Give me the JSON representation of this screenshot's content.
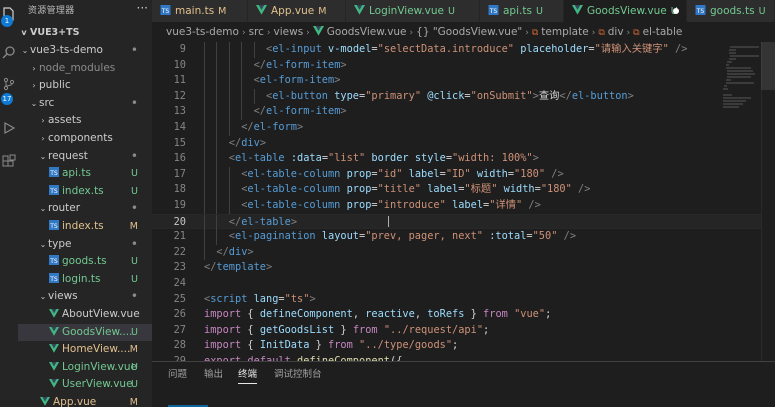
{
  "sidebar": {
    "title": "资源管理器",
    "section": "VUE3+TS",
    "items": [
      {
        "label": "vue3-ts-demo",
        "chev": "v",
        "depth": 1,
        "kind": "folder",
        "status": "•",
        "st": "dot"
      },
      {
        "label": "node_modules",
        "chev": ">",
        "depth": 2,
        "kind": "dim",
        "status": "",
        "st": ""
      },
      {
        "label": "public",
        "chev": ">",
        "depth": 2,
        "kind": "folder",
        "status": "",
        "st": ""
      },
      {
        "label": "src",
        "chev": "v",
        "depth": 2,
        "kind": "folder",
        "status": "•",
        "st": "dot"
      },
      {
        "label": "assets",
        "chev": ">",
        "depth": 3,
        "kind": "folder",
        "status": "",
        "st": ""
      },
      {
        "label": "components",
        "chev": ">",
        "depth": 3,
        "kind": "folder",
        "status": "",
        "st": ""
      },
      {
        "label": "request",
        "chev": "v",
        "depth": 3,
        "kind": "ts",
        "status": "•",
        "st": "dot"
      },
      {
        "label": "api.ts",
        "chev": "",
        "depth": 4,
        "kind": "tsfile",
        "status": "U",
        "st": "u"
      },
      {
        "label": "index.ts",
        "chev": "",
        "depth": 4,
        "kind": "tsfile",
        "status": "U",
        "st": "u"
      },
      {
        "label": "router",
        "chev": "v",
        "depth": 3,
        "kind": "folder",
        "status": "•",
        "st": "dot"
      },
      {
        "label": "index.ts",
        "chev": "",
        "depth": 4,
        "kind": "tsfilem",
        "status": "M",
        "st": "m"
      },
      {
        "label": "type",
        "chev": "v",
        "depth": 3,
        "kind": "ts",
        "status": "•",
        "st": "dot"
      },
      {
        "label": "goods.ts",
        "chev": "",
        "depth": 4,
        "kind": "tsfile",
        "status": "U",
        "st": "u"
      },
      {
        "label": "login.ts",
        "chev": "",
        "depth": 4,
        "kind": "tsfile",
        "status": "U",
        "st": "u"
      },
      {
        "label": "views",
        "chev": "v",
        "depth": 3,
        "kind": "folder",
        "status": "•",
        "st": "dot"
      },
      {
        "label": "AboutView.vue",
        "chev": "",
        "depth": 4,
        "kind": "vue",
        "status": "",
        "st": ""
      },
      {
        "label": "GoodsView....",
        "chev": "",
        "depth": 4,
        "kind": "vueu",
        "status": "U",
        "st": "u",
        "selected": true
      },
      {
        "label": "HomeView....",
        "chev": "",
        "depth": 4,
        "kind": "vuem",
        "status": "M",
        "st": "m"
      },
      {
        "label": "LoginView.vue",
        "chev": "",
        "depth": 4,
        "kind": "vueu",
        "status": "U",
        "st": "u"
      },
      {
        "label": "UserView.vue",
        "chev": "",
        "depth": 4,
        "kind": "vueu",
        "status": "U",
        "st": "u"
      },
      {
        "label": "App.vue",
        "chev": "",
        "depth": 3,
        "kind": "vuem",
        "status": "M",
        "st": "m"
      }
    ]
  },
  "activity_badges": [
    "1",
    "17"
  ],
  "tabs": [
    {
      "label": "main.ts",
      "badge": "M",
      "icon": "ts",
      "kind": "m"
    },
    {
      "label": "App.vue",
      "badge": "M",
      "icon": "vue",
      "kind": "m"
    },
    {
      "label": "LoginView.vue",
      "badge": "U",
      "icon": "vue",
      "kind": "u"
    },
    {
      "label": "api.ts",
      "badge": "U",
      "icon": "ts",
      "kind": "u"
    },
    {
      "label": "GoodsView.vue",
      "badge": "U",
      "icon": "vue",
      "kind": "u",
      "active": true
    },
    {
      "label": "goods.ts",
      "badge": "U",
      "icon": "ts",
      "kind": "u"
    }
  ],
  "breadcrumb": [
    "vue3-ts-demo",
    "src",
    "views",
    "GoodsView.vue",
    "{} \"GoodsView.vue\"",
    "template",
    "div",
    "el-table"
  ],
  "editor": {
    "current_line": 20,
    "lines": [
      {
        "n": 9,
        "indent": 6,
        "tokens": [
          [
            "t-pun",
            "<"
          ],
          [
            "t-tag",
            "el-input"
          ],
          [
            "t-txt",
            " "
          ],
          [
            "t-attr",
            "v-model"
          ],
          [
            "t-txt",
            "="
          ],
          [
            "t-str",
            "\"selectData.introduce\""
          ],
          [
            "t-txt",
            " "
          ],
          [
            "t-attr",
            "placeholder"
          ],
          [
            "t-txt",
            "="
          ],
          [
            "t-str",
            "\"请输入关键字\""
          ],
          [
            "t-txt",
            " "
          ],
          [
            "t-pun",
            "/>"
          ]
        ]
      },
      {
        "n": 10,
        "indent": 5,
        "tokens": [
          [
            "t-pun",
            "</"
          ],
          [
            "t-tag",
            "el-form-item"
          ],
          [
            "t-pun",
            ">"
          ]
        ]
      },
      {
        "n": 11,
        "indent": 5,
        "tokens": [
          [
            "t-pun",
            "<"
          ],
          [
            "t-tag",
            "el-form-item"
          ],
          [
            "t-pun",
            ">"
          ]
        ]
      },
      {
        "n": 12,
        "indent": 6,
        "tokens": [
          [
            "t-pun",
            "<"
          ],
          [
            "t-tag",
            "el-button"
          ],
          [
            "t-txt",
            " "
          ],
          [
            "t-attr",
            "type"
          ],
          [
            "t-txt",
            "="
          ],
          [
            "t-str",
            "\"primary\""
          ],
          [
            "t-txt",
            " "
          ],
          [
            "t-attr",
            "@click"
          ],
          [
            "t-txt",
            "="
          ],
          [
            "t-str",
            "\"onSubmit\""
          ],
          [
            "t-pun",
            ">"
          ],
          [
            "t-txt",
            "查询"
          ],
          [
            "t-pun",
            "</"
          ],
          [
            "t-tag",
            "el-button"
          ],
          [
            "t-pun",
            ">"
          ]
        ]
      },
      {
        "n": 13,
        "indent": 5,
        "tokens": [
          [
            "t-pun",
            "</"
          ],
          [
            "t-tag",
            "el-form-item"
          ],
          [
            "t-pun",
            ">"
          ]
        ]
      },
      {
        "n": 14,
        "indent": 4,
        "tokens": [
          [
            "t-pun",
            "</"
          ],
          [
            "t-tag",
            "el-form"
          ],
          [
            "t-pun",
            ">"
          ]
        ]
      },
      {
        "n": 15,
        "indent": 3,
        "tokens": [
          [
            "t-pun",
            "</"
          ],
          [
            "t-tag",
            "div"
          ],
          [
            "t-pun",
            ">"
          ]
        ]
      },
      {
        "n": 16,
        "indent": 3,
        "tokens": [
          [
            "t-pun",
            "<"
          ],
          [
            "t-tag",
            "el-table"
          ],
          [
            "t-txt",
            " "
          ],
          [
            "t-attr",
            ":data"
          ],
          [
            "t-txt",
            "="
          ],
          [
            "t-str",
            "\"list\""
          ],
          [
            "t-txt",
            " "
          ],
          [
            "t-attr",
            "border"
          ],
          [
            "t-txt",
            " "
          ],
          [
            "t-attr",
            "style"
          ],
          [
            "t-txt",
            "="
          ],
          [
            "t-str",
            "\"width: 100%\""
          ],
          [
            "t-pun",
            ">"
          ]
        ]
      },
      {
        "n": 17,
        "indent": 4,
        "tokens": [
          [
            "t-pun",
            "<"
          ],
          [
            "t-tag",
            "el-table-column"
          ],
          [
            "t-txt",
            " "
          ],
          [
            "t-attr",
            "prop"
          ],
          [
            "t-txt",
            "="
          ],
          [
            "t-str",
            "\"id\""
          ],
          [
            "t-txt",
            " "
          ],
          [
            "t-attr",
            "label"
          ],
          [
            "t-txt",
            "="
          ],
          [
            "t-str",
            "\"ID\""
          ],
          [
            "t-txt",
            " "
          ],
          [
            "t-attr",
            "width"
          ],
          [
            "t-txt",
            "="
          ],
          [
            "t-str",
            "\"180\""
          ],
          [
            "t-txt",
            " "
          ],
          [
            "t-pun",
            "/>"
          ]
        ]
      },
      {
        "n": 18,
        "indent": 4,
        "tokens": [
          [
            "t-pun",
            "<"
          ],
          [
            "t-tag",
            "el-table-column"
          ],
          [
            "t-txt",
            " "
          ],
          [
            "t-attr",
            "prop"
          ],
          [
            "t-txt",
            "="
          ],
          [
            "t-str",
            "\"title\""
          ],
          [
            "t-txt",
            " "
          ],
          [
            "t-attr",
            "label"
          ],
          [
            "t-txt",
            "="
          ],
          [
            "t-str",
            "\"标题\""
          ],
          [
            "t-txt",
            " "
          ],
          [
            "t-attr",
            "width"
          ],
          [
            "t-txt",
            "="
          ],
          [
            "t-str",
            "\"180\""
          ],
          [
            "t-txt",
            " "
          ],
          [
            "t-pun",
            "/>"
          ]
        ]
      },
      {
        "n": 19,
        "indent": 4,
        "tokens": [
          [
            "t-pun",
            "<"
          ],
          [
            "t-tag",
            "el-table-column"
          ],
          [
            "t-txt",
            " "
          ],
          [
            "t-attr",
            "prop"
          ],
          [
            "t-txt",
            "="
          ],
          [
            "t-str",
            "\"introduce\""
          ],
          [
            "t-txt",
            " "
          ],
          [
            "t-attr",
            "label"
          ],
          [
            "t-txt",
            "="
          ],
          [
            "t-str",
            "\"详情\""
          ],
          [
            "t-txt",
            " "
          ],
          [
            "t-pun",
            "/>"
          ]
        ]
      },
      {
        "n": 20,
        "indent": 3,
        "tokens": [
          [
            "t-pun",
            "</"
          ],
          [
            "t-tag",
            "el-table"
          ],
          [
            "t-pun",
            ">"
          ]
        ]
      },
      {
        "n": 21,
        "indent": 3,
        "tokens": [
          [
            "t-pun",
            "<"
          ],
          [
            "t-tag",
            "el-pagination"
          ],
          [
            "t-txt",
            " "
          ],
          [
            "t-attr",
            "layout"
          ],
          [
            "t-txt",
            "="
          ],
          [
            "t-str",
            "\"prev, pager, next\""
          ],
          [
            "t-txt",
            " "
          ],
          [
            "t-attr",
            ":total"
          ],
          [
            "t-txt",
            "="
          ],
          [
            "t-str",
            "\"50\""
          ],
          [
            "t-txt",
            " "
          ],
          [
            "t-pun",
            "/>"
          ]
        ]
      },
      {
        "n": 22,
        "indent": 2,
        "tokens": [
          [
            "t-pun",
            "</"
          ],
          [
            "t-tag",
            "div"
          ],
          [
            "t-pun",
            ">"
          ]
        ]
      },
      {
        "n": 23,
        "indent": 1,
        "tokens": [
          [
            "t-pun",
            "</"
          ],
          [
            "t-tag",
            "template"
          ],
          [
            "t-pun",
            ">"
          ]
        ]
      },
      {
        "n": 24,
        "indent": 0,
        "tokens": []
      },
      {
        "n": 25,
        "indent": 1,
        "tokens": [
          [
            "t-pun",
            "<"
          ],
          [
            "t-tag",
            "script"
          ],
          [
            "t-txt",
            " "
          ],
          [
            "t-attr",
            "lang"
          ],
          [
            "t-txt",
            "="
          ],
          [
            "t-str",
            "\"ts\""
          ],
          [
            "t-pun",
            ">"
          ]
        ]
      },
      {
        "n": 26,
        "indent": 1,
        "tokens": [
          [
            "t-kw",
            "import"
          ],
          [
            "t-txt",
            " { "
          ],
          [
            "t-var",
            "defineComponent"
          ],
          [
            "t-txt",
            ", "
          ],
          [
            "t-var",
            "reactive"
          ],
          [
            "t-txt",
            ", "
          ],
          [
            "t-var",
            "toRefs"
          ],
          [
            "t-txt",
            " } "
          ],
          [
            "t-kw",
            "from"
          ],
          [
            "t-txt",
            " "
          ],
          [
            "t-str",
            "\"vue\""
          ],
          [
            "t-txt",
            ";"
          ]
        ]
      },
      {
        "n": 27,
        "indent": 1,
        "tokens": [
          [
            "t-kw",
            "import"
          ],
          [
            "t-txt",
            " { "
          ],
          [
            "t-var",
            "getGoodsList"
          ],
          [
            "t-txt",
            " } "
          ],
          [
            "t-kw",
            "from"
          ],
          [
            "t-txt",
            " "
          ],
          [
            "t-str",
            "\"../request/api\""
          ],
          [
            "t-txt",
            ";"
          ]
        ]
      },
      {
        "n": 28,
        "indent": 1,
        "tokens": [
          [
            "t-kw",
            "import"
          ],
          [
            "t-txt",
            " { "
          ],
          [
            "t-var",
            "InitData"
          ],
          [
            "t-txt",
            " } "
          ],
          [
            "t-kw",
            "from"
          ],
          [
            "t-txt",
            " "
          ],
          [
            "t-str",
            "\"../type/goods\""
          ],
          [
            "t-txt",
            ";"
          ]
        ]
      },
      {
        "n": 29,
        "indent": 1,
        "tokens": [
          [
            "t-kw",
            "export"
          ],
          [
            "t-txt",
            " "
          ],
          [
            "t-kw",
            "default"
          ],
          [
            "t-txt",
            " "
          ],
          [
            "t-fn",
            "defineComponent"
          ],
          [
            "t-txt",
            "({"
          ]
        ]
      }
    ]
  },
  "panel": {
    "tabs": [
      "问题",
      "输出",
      "终端",
      "调试控制台"
    ],
    "active": 2
  }
}
